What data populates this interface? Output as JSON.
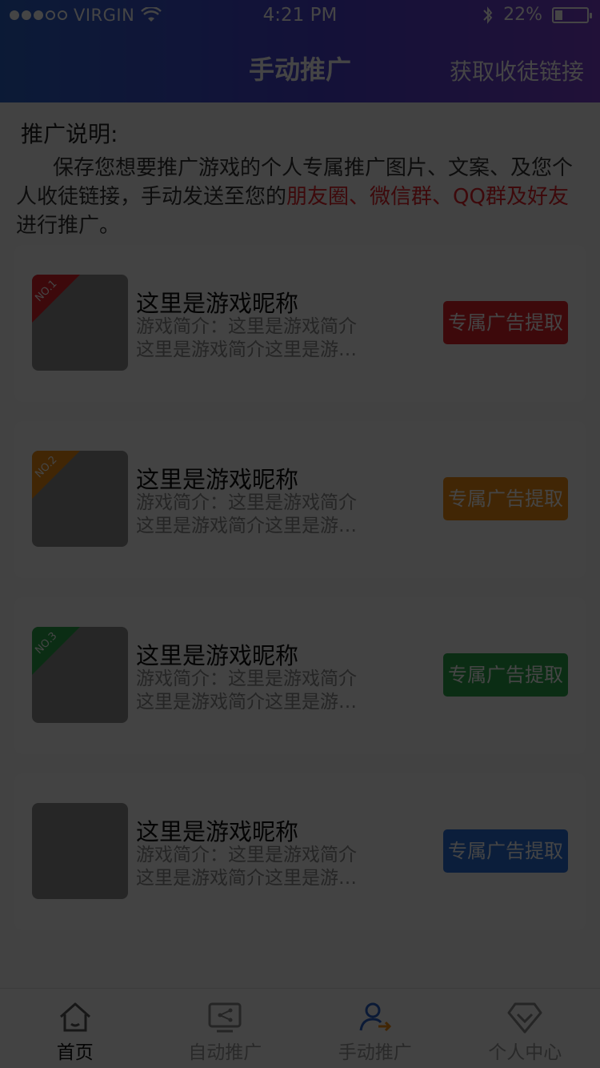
{
  "status_bar": {
    "carrier": "VIRGIN",
    "time": "4:21 PM",
    "battery": "22%",
    "battery_level": 0.22
  },
  "navbar": {
    "title": "手动推广",
    "action_label": "获取收徒链接"
  },
  "intro": {
    "title": "推广说明:",
    "text_before": "保存您想要推广游戏的个人专属推广图片、文案、及您个人收徒链接，手动发送至您的",
    "text_highlight": "朋友圈、微信群、QQ群及好友",
    "text_after": "进行推广。"
  },
  "games": [
    {
      "rank": "NO.1",
      "rank_color": "#e0212a",
      "name": "这里是游戏昵称",
      "desc_line1": "游戏简介：这里是游戏简介",
      "desc_line2": "这里是游戏简介这里是游戏简介",
      "button_label": "专属广告提取",
      "button_color": "#e0212a"
    },
    {
      "rank": "NO.2",
      "rank_color": "#f08e13",
      "name": "这里是游戏昵称",
      "desc_line1": "游戏简介：这里是游戏简介",
      "desc_line2": "这里是游戏简介这里是游戏简介",
      "button_label": "专属广告提取",
      "button_color": "#f08e13"
    },
    {
      "rank": "NO.3",
      "rank_color": "#2aa84a",
      "name": "这里是游戏昵称",
      "desc_line1": "游戏简介：这里是游戏简介",
      "desc_line2": "这里是游戏简介这里是游戏简介",
      "button_label": "专属广告提取",
      "button_color": "#2aa84a"
    },
    {
      "rank": "",
      "rank_color": "",
      "name": "这里是游戏昵称",
      "desc_line1": "游戏简介：这里是游戏简介",
      "desc_line2": "这里是游戏简介这里是游戏简介",
      "button_label": "专属广告提取",
      "button_color": "#2b71d8"
    }
  ],
  "tabbar": {
    "tabs": [
      {
        "label": "首页",
        "icon": "home-icon",
        "active": true
      },
      {
        "label": "自动推广",
        "icon": "share-screen-icon",
        "active": false
      },
      {
        "label": "手动推广",
        "icon": "user-arrow-icon",
        "active": false
      },
      {
        "label": "个人中心",
        "icon": "diamond-check-icon",
        "active": false
      }
    ]
  },
  "colors": {
    "header_gradient_start": "#2b62c9",
    "header_gradient_end": "#7a3fcf",
    "highlight": "#e0212a",
    "overlay": "rgba(0,0,0,0.73)"
  }
}
